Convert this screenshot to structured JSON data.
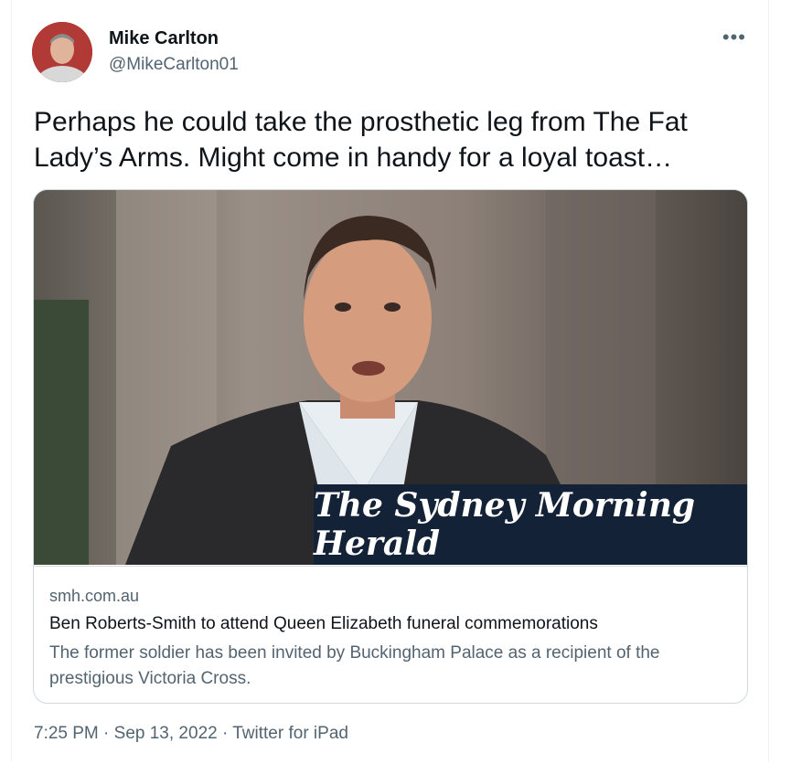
{
  "author": {
    "name": "Mike Carlton",
    "handle": "@MikeCarlton01"
  },
  "more_icon": "•••",
  "tweet_text": "Perhaps he could take the prosthetic leg from The Fat Lady’s Arms. Might come in handy for a loyal toast…",
  "card": {
    "masthead": "The Sydney Morning Herald",
    "domain": "smh.com.au",
    "title": "Ben Roberts-Smith to attend Queen Elizabeth funeral commemorations",
    "description": "The former soldier has been invited by Buckingham Palace as a recipient of the prestigious Victoria Cross."
  },
  "meta": {
    "time": "7:25 PM",
    "sep1": "·",
    "date": "Sep 13, 2022",
    "sep2": "·",
    "source": "Twitter for iPad"
  },
  "colors": {
    "secondary_text": "#536471",
    "border": "#cfd9de",
    "masthead_bg": "#142238"
  }
}
